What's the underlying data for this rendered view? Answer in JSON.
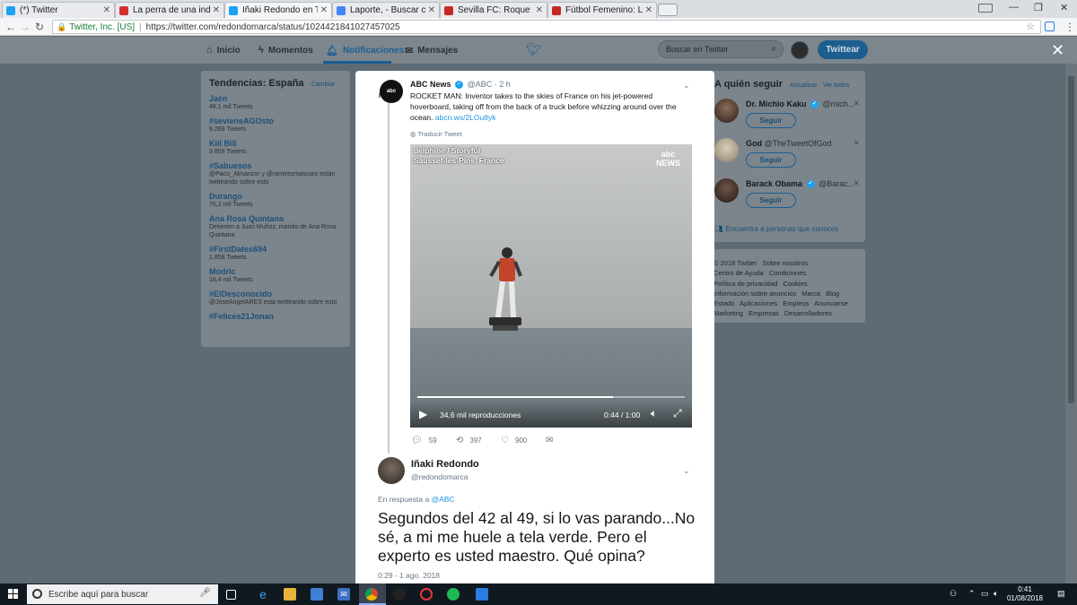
{
  "browser": {
    "tabs": [
      {
        "title": "(*) Twitter",
        "color": "#1da1f2"
      },
      {
        "title": "La perra de una indepen",
        "color": "#d32f2f"
      },
      {
        "title": "Iñaki Redondo en Twitter",
        "color": "#1da1f2"
      },
      {
        "title": "Laporte, - Buscar con Go",
        "color": "#4285f4"
      },
      {
        "title": "Sevilla FC: Roque Mesa: ",
        "color": "#c62828"
      },
      {
        "title": "Fútbol Femenino: Las est",
        "color": "#c62828"
      }
    ],
    "secure_label": "Twitter, Inc. [US]",
    "url": "https://twitter.com/redondomarca/status/1024421841027457025"
  },
  "nav": {
    "home": "Inicio",
    "moments": "Momentos",
    "notifications": "Notificaciones",
    "messages": "Mensajes",
    "search_placeholder": "Buscar en Twitter",
    "tweet_button": "Twittear"
  },
  "trends": {
    "title": "Tendencias: España",
    "change": "· Cambiar",
    "items": [
      {
        "name": "Jaén",
        "meta": "48,1 mil Tweets"
      },
      {
        "name": "#sevieneAGOsto",
        "meta": "9.269 Tweets"
      },
      {
        "name": "Kill Bill",
        "meta": "3.859 Tweets"
      },
      {
        "name": "#Sabuesos",
        "meta": "@Paco_Almanzor y @ramirezmascaro están twitteando sobre esto"
      },
      {
        "name": "Durango",
        "meta": "76,2 mil Tweets"
      },
      {
        "name": "Ana Rosa Quintana",
        "meta": "Detienen a Juan Muñoz, marido de Ana Rosa Quintana"
      },
      {
        "name": "#FirstDates694",
        "meta": "1.858 Tweets"
      },
      {
        "name": "Modric",
        "meta": "16,4 mil Tweets"
      },
      {
        "name": "#ElDesconocido",
        "meta": "@JoseAngelARES está twitteando sobre esto"
      },
      {
        "name": "#Felices21Jonan",
        "meta": ""
      }
    ]
  },
  "who_to_follow": {
    "title": "A quién seguir",
    "links": "· Actualizar · Ver todos",
    "accounts": [
      {
        "name": "Dr. Michio Kaku",
        "handle": "@mich...",
        "follow": "Seguir"
      },
      {
        "name": "God",
        "handle": "@TheTweetOfGod",
        "follow": "Seguir"
      },
      {
        "name": "Barack Obama",
        "handle": "@Barac...",
        "follow": "Seguir"
      }
    ],
    "find_people": "Encuentra a personas que conoces"
  },
  "footer_links": [
    "© 2018 Twitter",
    "Sobre nosotros",
    "Centro de Ayuda",
    "Condiciones",
    "Política de privacidad",
    "Cookies",
    "Información sobre anuncios",
    "Marca",
    "Blog",
    "Estado",
    "Aplicaciones",
    "Empleos",
    "Anunciarse",
    "Marketing",
    "Empresas",
    "Desarrolladores"
  ],
  "quoted_tweet": {
    "name": "ABC News",
    "handle": "@ABC",
    "time": "· 2 h",
    "avatar_text": "abc",
    "avatar_sub": "NEWS",
    "text": "ROCKET MAN: Inventor takes to the skies of France on his jet-powered hoverboard, taking off from the back of a truck before whizzing around over the ocean.",
    "link": "abcn.ws/2LOu8yk",
    "translate": "Traducir Tweet",
    "video": {
      "source_line1": "delphine / Storyful",
      "source_line2": "Sausset-les-Pins, France",
      "logo_top": "abc",
      "logo_bottom": "NEWS",
      "views": "34,6 mil reproducciones",
      "time": "0:44 / 1:00",
      "progress": 0.73
    },
    "replies": "59",
    "retweets": "397",
    "likes": "900"
  },
  "reply_tweet": {
    "name": "Iñaki Redondo",
    "handle": "@redondomarca",
    "in_reply_prefix": "En respuesta a",
    "in_reply_to": "@ABC",
    "text": "Segundos del 42 al 49, si lo vas parando...No sé, a mi me huele a tela verde. Pero el experto es usted maestro. Qué opina?",
    "timestamp": "0:29 - 1 ago. 2018"
  },
  "taskbar": {
    "search_placeholder": "Escribe aquí para buscar",
    "time": "0:41",
    "date": "01/08/2018"
  }
}
